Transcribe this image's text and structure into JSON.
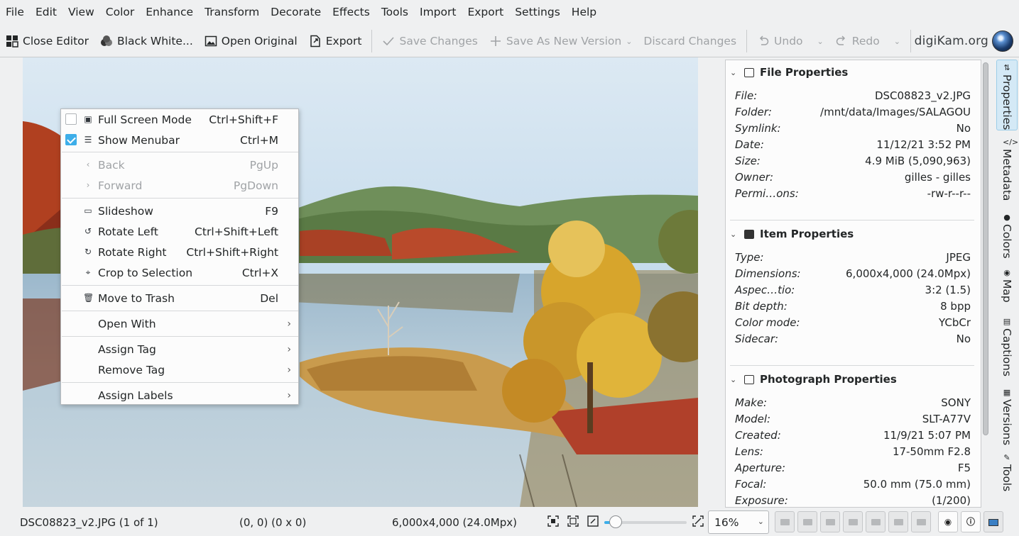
{
  "menubar": [
    "File",
    "Edit",
    "View",
    "Color",
    "Enhance",
    "Transform",
    "Decorate",
    "Effects",
    "Tools",
    "Import",
    "Export",
    "Settings",
    "Help"
  ],
  "toolbar": {
    "close_editor": "Close Editor",
    "black_white": "Black  White...",
    "open_original": "Open Original",
    "export": "Export",
    "save_changes": "Save Changes",
    "save_as_new": "Save As New Version",
    "discard": "Discard Changes",
    "undo": "Undo",
    "redo": "Redo",
    "brand": "digiKam.org"
  },
  "context_menu": {
    "full_screen": {
      "label": "Full Screen Mode",
      "shortcut": "Ctrl+Shift+F",
      "checked": false
    },
    "show_menubar": {
      "label": "Show Menubar",
      "shortcut": "Ctrl+M",
      "checked": true
    },
    "back": {
      "label": "Back",
      "shortcut": "PgUp"
    },
    "forward": {
      "label": "Forward",
      "shortcut": "PgDown"
    },
    "slideshow": {
      "label": "Slideshow",
      "shortcut": "F9"
    },
    "rotate_left": {
      "label": "Rotate Left",
      "shortcut": "Ctrl+Shift+Left"
    },
    "rotate_right": {
      "label": "Rotate Right",
      "shortcut": "Ctrl+Shift+Right"
    },
    "crop": {
      "label": "Crop to Selection",
      "shortcut": "Ctrl+X"
    },
    "trash": {
      "label": "Move to Trash",
      "shortcut": "Del"
    },
    "open_with": {
      "label": "Open With"
    },
    "assign_tag": {
      "label": "Assign Tag"
    },
    "remove_tag": {
      "label": "Remove Tag"
    },
    "assign_labels": {
      "label": "Assign Labels"
    }
  },
  "properties": {
    "file": {
      "title": "File Properties",
      "rows": [
        {
          "k": "File:",
          "v": "DSC08823_v2.JPG"
        },
        {
          "k": "Folder:",
          "v": "/mnt/data/Images/SALAGOU"
        },
        {
          "k": "Symlink:",
          "v": "No"
        },
        {
          "k": "Date:",
          "v": "11/12/21 3:52 PM"
        },
        {
          "k": "Size:",
          "v": "4.9 MiB (5,090,963)"
        },
        {
          "k": "Owner:",
          "v": "gilles - gilles"
        },
        {
          "k": "Permi…ons:",
          "v": "-rw-r--r--"
        }
      ]
    },
    "item": {
      "title": "Item Properties",
      "rows": [
        {
          "k": "Type:",
          "v": "JPEG"
        },
        {
          "k": "Dimensions:",
          "v": "6,000x4,000 (24.0Mpx)"
        },
        {
          "k": "Aspec…tio:",
          "v": "3:2 (1.5)"
        },
        {
          "k": "Bit depth:",
          "v": "8 bpp"
        },
        {
          "k": "Color mode:",
          "v": "YCbCr"
        },
        {
          "k": "Sidecar:",
          "v": "No"
        }
      ]
    },
    "photo": {
      "title": "Photograph Properties",
      "rows": [
        {
          "k": "Make:",
          "v": "SONY"
        },
        {
          "k": "Model:",
          "v": "SLT-A77V"
        },
        {
          "k": "Created:",
          "v": "11/9/21 5:07 PM"
        },
        {
          "k": "Lens:",
          "v": "17-50mm F2.8"
        },
        {
          "k": "Aperture:",
          "v": "F5"
        },
        {
          "k": "Focal:",
          "v": "50.0 mm (75.0 mm)"
        },
        {
          "k": "Exposure:",
          "v": "(1/200)"
        }
      ]
    }
  },
  "sidetabs": [
    "Properties",
    "Metadata",
    "Colors",
    "Map",
    "Captions",
    "Versions",
    "Tools"
  ],
  "status": {
    "file": "DSC08823_v2.JPG (1 of 1)",
    "coords": "(0, 0) (0 x 0)",
    "dims": "6,000x4,000 (24.0Mpx)",
    "zoom": "16%",
    "zoom_slider_fraction": 0.14
  }
}
